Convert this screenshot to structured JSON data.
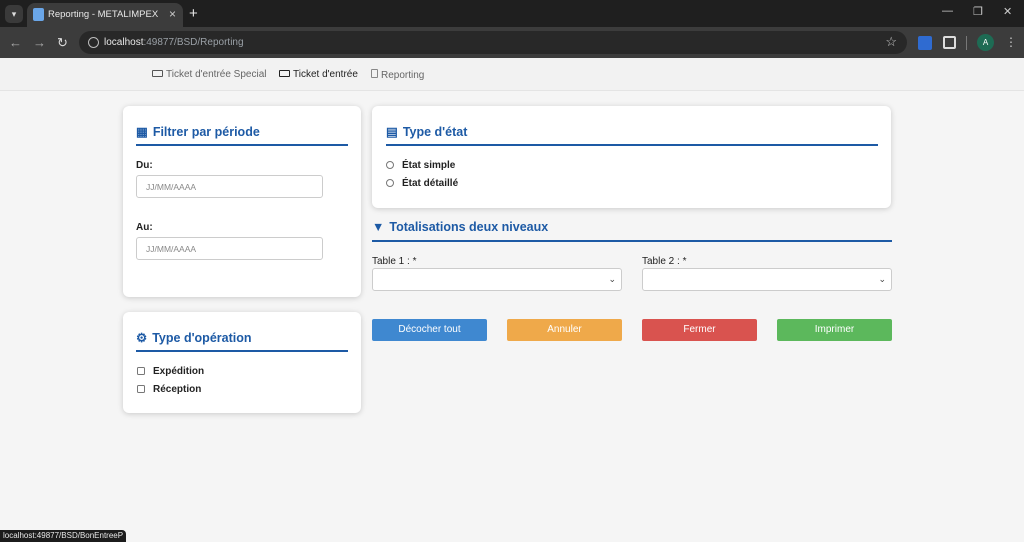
{
  "browser": {
    "tab_title": "Reporting - METALIMPEX",
    "url_host": "localhost",
    "url_path": ":49877/BSD/Reporting",
    "avatar_letter": "A",
    "status_url": "localhost:49877/BSD/BonEntreeP"
  },
  "topnav": {
    "items": [
      {
        "label": "Ticket d'entrée Special"
      },
      {
        "label": "Ticket d'entrée"
      },
      {
        "label": "Reporting"
      }
    ]
  },
  "filter_period": {
    "title": "Filtrer par période",
    "du_label": "Du:",
    "au_label": "Au:",
    "du_placeholder": "JJ/MM/AAAA",
    "au_placeholder": "JJ/MM/AAAA"
  },
  "operation_type": {
    "title": "Type d'opération",
    "options": [
      "Expédition",
      "Réception"
    ]
  },
  "state_type": {
    "title": "Type d'état",
    "options": [
      "État simple",
      "État détaillé"
    ]
  },
  "totals": {
    "title": "Totalisations deux niveaux",
    "table1_label": "Table 1 : *",
    "table2_label": "Table 2 : *"
  },
  "buttons": {
    "uncheck_all": "Décocher tout",
    "cancel": "Annuler",
    "close": "Fermer",
    "print": "Imprimer"
  },
  "colors": {
    "accent": "#1d5aa5",
    "uncheck": "#3f88d0",
    "cancel": "#efa94a",
    "close": "#d9534f",
    "print": "#5cb85c"
  }
}
